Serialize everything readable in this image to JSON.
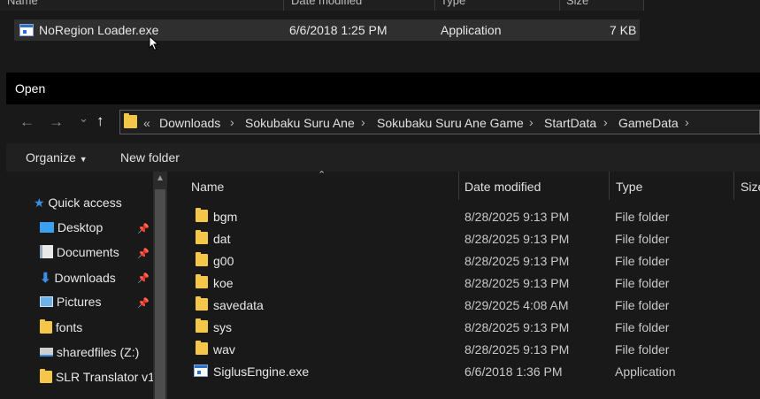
{
  "background_window": {
    "columns": [
      "Name",
      "Date modified",
      "Type",
      "Size"
    ],
    "row": {
      "name": "NoRegion Loader.exe",
      "date": "6/6/2018 1:25 PM",
      "type": "Application",
      "size": "7 KB"
    }
  },
  "dialog": {
    "title": "Open",
    "nav": {
      "back": "←",
      "forward": "→",
      "recent": "⌄",
      "up": "↑"
    },
    "breadcrumb": [
      "Downloads",
      "Sokubaku Suru Ane",
      "Sokubaku Suru Ane Game",
      "StartData",
      "GameData"
    ],
    "breadcrumb_overflow": "«",
    "toolbar": {
      "organize": "Organize",
      "new_folder": "New folder"
    },
    "nav_pane": [
      {
        "label": "Quick access",
        "icon": "star-icon",
        "pinned": false
      },
      {
        "label": "Desktop",
        "icon": "desktop-icon",
        "pinned": true
      },
      {
        "label": "Documents",
        "icon": "documents-icon",
        "pinned": true
      },
      {
        "label": "Downloads",
        "icon": "downloads-icon",
        "pinned": true
      },
      {
        "label": "Pictures",
        "icon": "pictures-icon",
        "pinned": true
      },
      {
        "label": "fonts",
        "icon": "folder-icon",
        "pinned": false
      },
      {
        "label": "sharedfiles (Z:)",
        "icon": "network-drive-icon",
        "pinned": false
      },
      {
        "label": "SLR Translator v1",
        "icon": "folder-icon",
        "pinned": false
      }
    ],
    "columns": {
      "name": "Name",
      "date": "Date modified",
      "type": "Type",
      "size": "Size"
    },
    "files": [
      {
        "name": "bgm",
        "date": "8/28/2025 9:13 PM",
        "type": "File folder",
        "icon": "folder-icon"
      },
      {
        "name": "dat",
        "date": "8/28/2025 9:13 PM",
        "type": "File folder",
        "icon": "folder-icon"
      },
      {
        "name": "g00",
        "date": "8/28/2025 9:13 PM",
        "type": "File folder",
        "icon": "folder-icon"
      },
      {
        "name": "koe",
        "date": "8/28/2025 9:13 PM",
        "type": "File folder",
        "icon": "folder-icon"
      },
      {
        "name": "savedata",
        "date": "8/29/2025 4:08 AM",
        "type": "File folder",
        "icon": "folder-icon"
      },
      {
        "name": "sys",
        "date": "8/28/2025 9:13 PM",
        "type": "File folder",
        "icon": "folder-icon"
      },
      {
        "name": "wav",
        "date": "8/28/2025 9:13 PM",
        "type": "File folder",
        "icon": "folder-icon"
      },
      {
        "name": "SiglusEngine.exe",
        "date": "6/6/2018 1:36 PM",
        "type": "Application",
        "icon": "exe-icon"
      }
    ]
  },
  "colors": {
    "folder": "#f4c749",
    "titlebar": "#000000",
    "background": "#191919"
  }
}
